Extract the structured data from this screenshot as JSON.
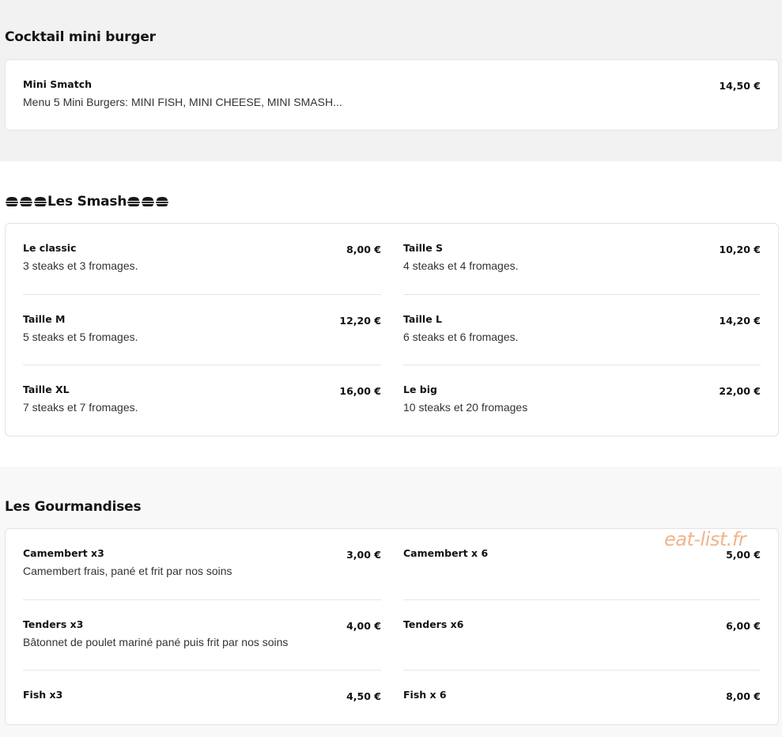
{
  "sections": {
    "cocktail": {
      "title": "Cocktail mini burger",
      "items": [
        {
          "name": "Mini Smatch",
          "desc": "Menu 5 Mini Burgers: MINI FISH, MINI CHEESE, MINI SMASH...",
          "price": "14,50 €"
        }
      ]
    },
    "smash": {
      "title": "Les Smash",
      "title_icon": "burger-icon",
      "items": [
        {
          "name": "Le classic",
          "desc": "3 steaks et 3 fromages.",
          "price": "8,00 €"
        },
        {
          "name": "Taille S",
          "desc": "4 steaks et 4 fromages.",
          "price": "10,20 €"
        },
        {
          "name": "Taille M",
          "desc": "5 steaks et 5 fromages.",
          "price": "12,20 €"
        },
        {
          "name": "Taille L",
          "desc": "6 steaks et 6 fromages.",
          "price": "14,20 €"
        },
        {
          "name": "Taille XL",
          "desc": "7 steaks et 7 fromages.",
          "price": "16,00 €"
        },
        {
          "name": "Le big",
          "desc": "10 steaks et 20 fromages",
          "price": "22,00 €"
        }
      ]
    },
    "gourmandises": {
      "title": "Les Gourmandises",
      "items": [
        {
          "name": "Camembert x3",
          "desc": "Camembert frais, pané et frit par nos soins",
          "price": "3,00 €"
        },
        {
          "name": "Camembert x 6",
          "desc": "",
          "price": "5,00 €"
        },
        {
          "name": "Tenders x3",
          "desc": "Bâtonnet de poulet mariné pané puis frit par nos soins",
          "price": "4,00 €"
        },
        {
          "name": "Tenders x6",
          "desc": "",
          "price": "6,00 €"
        },
        {
          "name": "Fish x3",
          "desc": "",
          "price": "4,50 €"
        },
        {
          "name": "Fish x 6",
          "desc": "",
          "price": "8,00 €"
        }
      ]
    }
  },
  "watermark": "eat-list.fr",
  "colors": {
    "watermark": "#f2b48a",
    "section_bg_1": "#f2f2f2",
    "section_bg_3": "#f8f8f8",
    "card_border": "#e3e3e3"
  }
}
